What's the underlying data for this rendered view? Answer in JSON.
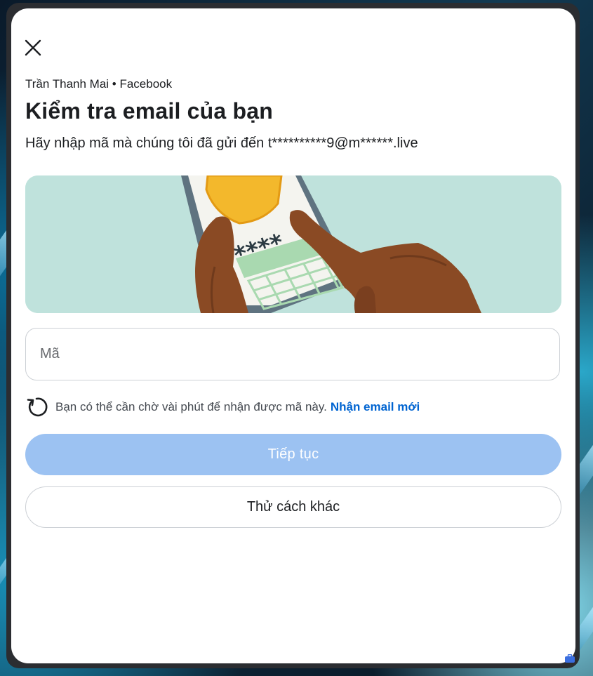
{
  "dialog": {
    "close_icon": "close-icon",
    "account_line": "Trần Thanh Mai • Facebook",
    "title": "Kiểm tra email của bạn",
    "subtitle": "Hãy nhập mã mà chúng tôi đã gửi đến t**********9@m******.live",
    "illustration": {
      "description_icon": "phone-code-illustration",
      "code_text": "****",
      "background_color": "#bfe2dc"
    },
    "code_field": {
      "placeholder": "Mã",
      "value": ""
    },
    "resend": {
      "icon": "refresh-icon",
      "text": "Bạn có thể cần chờ vài phút để nhận được mã này.",
      "link": "Nhận email mới"
    },
    "continue_button": "Tiếp tục",
    "other_button": "Thử cách khác"
  },
  "colors": {
    "primary_disabled": "#9cc2f2",
    "link": "#0064d1",
    "text": "#1c1e21"
  }
}
